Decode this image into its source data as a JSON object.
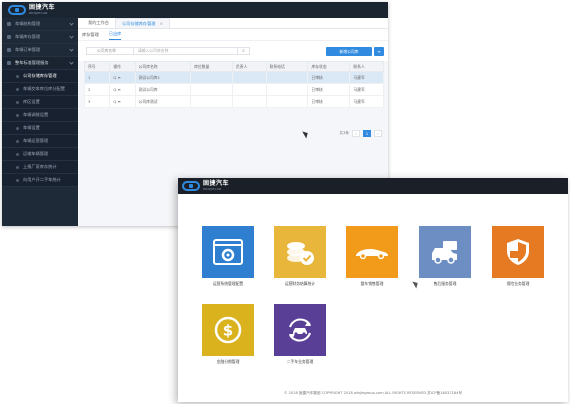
{
  "back_window": {
    "logo": {
      "cn": "固捷汽车",
      "en": "WINJIECAR"
    },
    "sidebar": [
      {
        "label": "车辆结构管理",
        "type": "group"
      },
      {
        "label": "车辆库存管理",
        "type": "group"
      },
      {
        "label": "车辆订单管理",
        "type": "group"
      },
      {
        "label": "整车标准管理服务",
        "type": "group-open"
      },
      {
        "label": "公司存储库存管理",
        "type": "active"
      },
      {
        "label": "车辆交车库位库分配置",
        "type": "sub"
      },
      {
        "label": "库区设置",
        "type": "sub"
      },
      {
        "label": "车辆调拨设置",
        "type": "sub"
      },
      {
        "label": "车辆设置",
        "type": "sub"
      },
      {
        "label": "车辆运营管理",
        "type": "sub"
      },
      {
        "label": "运输车辆管理",
        "type": "sub"
      },
      {
        "label": "上报厂家库存统计",
        "type": "sub"
      },
      {
        "label": "向用户开二手车统计",
        "type": "sub"
      }
    ],
    "tabs": [
      {
        "label": "我的工作台"
      },
      {
        "label": "公司存储库存管理",
        "close": "×"
      }
    ],
    "subtabs": [
      {
        "label": "库存管理"
      },
      {
        "label": "已出库"
      }
    ],
    "filter": {
      "select": "公司库名称",
      "placeholder": "请输入公司库名称",
      "new_button": "新增公司库",
      "more_button": "≡"
    },
    "table": {
      "headers": [
        "序号",
        "操作",
        "公司库名称",
        "库位数量",
        "负责人",
        "联系电话",
        "库存状态",
        "联系人"
      ],
      "rows": [
        [
          "1",
          "Q  ≡",
          "测试公司库1",
          "",
          "",
          "",
          "已审核",
          "马建军"
        ],
        [
          "2",
          "Q  ≡",
          "测试公司库",
          "",
          "",
          "",
          "已审核",
          "马建军"
        ],
        [
          "3",
          "Q  ≡",
          "公司库测试",
          "",
          "",
          "",
          "已审核",
          "马建军"
        ]
      ]
    },
    "pager": {
      "total": "共3条",
      "prev": "‹",
      "page": "1",
      "next": "›"
    }
  },
  "front_window": {
    "logo": {
      "cn": "固捷汽车",
      "en": "WINJIECAR"
    },
    "tiles": [
      {
        "label": "运营系统管理配置",
        "color": "#2f7fd0",
        "icon": "settings-window-icon"
      },
      {
        "label": "运营财务结算统计",
        "color": "#e8b63a",
        "icon": "coins-check-icon"
      },
      {
        "label": "整车销售管理",
        "color": "#f29a1a",
        "icon": "sports-car-icon"
      },
      {
        "label": "售后服务管理",
        "color": "#6c8ec2",
        "icon": "car-wrench-icon"
      },
      {
        "label": "保险业务管理",
        "color": "#e67a22",
        "icon": "shield-icon"
      },
      {
        "label": "金融分期管理",
        "color": "#d9b21e",
        "icon": "dollar-coin-icon"
      },
      {
        "label": "二手车业务管理",
        "color": "#5a3f96",
        "icon": "recycle-car-icon"
      }
    ],
    "footer": "© 2018 固捷汽车集团 COPYRIGHT 2018 winjiegroup.com ALL RIGHTS RESERVED 苏ICP备16037184号"
  }
}
